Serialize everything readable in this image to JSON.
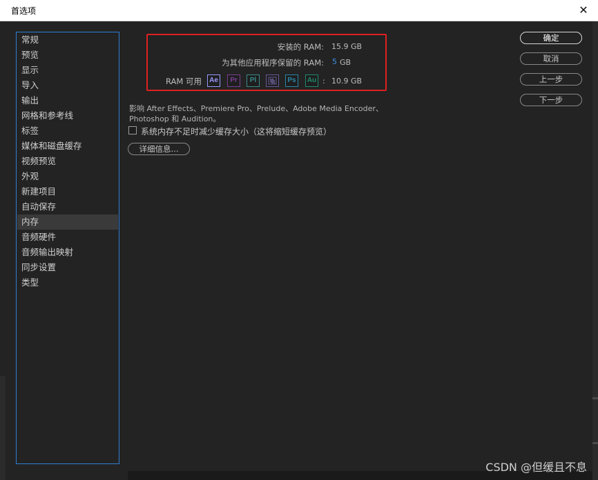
{
  "window": {
    "title": "首选项",
    "close_glyph": "✕"
  },
  "sidebar": {
    "items": [
      {
        "label": "常规"
      },
      {
        "label": "预览"
      },
      {
        "label": "显示"
      },
      {
        "label": "导入"
      },
      {
        "label": "输出"
      },
      {
        "label": "网格和参考线"
      },
      {
        "label": "标签"
      },
      {
        "label": "媒体和磁盘缓存"
      },
      {
        "label": "视频预览"
      },
      {
        "label": "外观"
      },
      {
        "label": "新建项目"
      },
      {
        "label": "自动保存"
      },
      {
        "label": "内存"
      },
      {
        "label": "音频硬件"
      },
      {
        "label": "音频输出映射"
      },
      {
        "label": "同步设置"
      },
      {
        "label": "类型"
      }
    ],
    "selected": "内存"
  },
  "memory": {
    "installed_label": "安装的 RAM:",
    "installed_value": "15.9 GB",
    "reserved_label": "为其他应用程序保留的 RAM:",
    "reserved_number": "5",
    "reserved_unit": "GB",
    "available_label": "RAM 可用",
    "apps": [
      {
        "abbr": "Ae",
        "color": "#9999ff",
        "icon": "after-effects-icon"
      },
      {
        "abbr": "Pr",
        "color": "#8a4fa3",
        "icon": "premiere-pro-icon"
      },
      {
        "abbr": "Pl",
        "color": "#3a8a8a",
        "icon": "prelude-icon"
      },
      {
        "abbr": "Me",
        "color": "#7a6aa8",
        "icon": "media-encoder-icon"
      },
      {
        "abbr": "Ps",
        "color": "#2a86a8",
        "icon": "photoshop-icon"
      },
      {
        "abbr": "Au",
        "color": "#1f8a6a",
        "icon": "audition-icon"
      }
    ],
    "available_colon": ":",
    "available_value": "10.9 GB",
    "affects_line1": "影响 After Effects、Premiere Pro、Prelude、Adobe Media Encoder、",
    "affects_line2": "Photoshop 和 Audition。",
    "reduce_cache_label": "系统内存不足时减少缓存大小（这将缩短缓存预览）",
    "reduce_cache_checked": false,
    "details_button": "详细信息..."
  },
  "buttons": {
    "ok": "确定",
    "cancel": "取消",
    "previous": "上一步",
    "next": "下一步"
  },
  "watermark": "CSDN @但缓且不息"
}
